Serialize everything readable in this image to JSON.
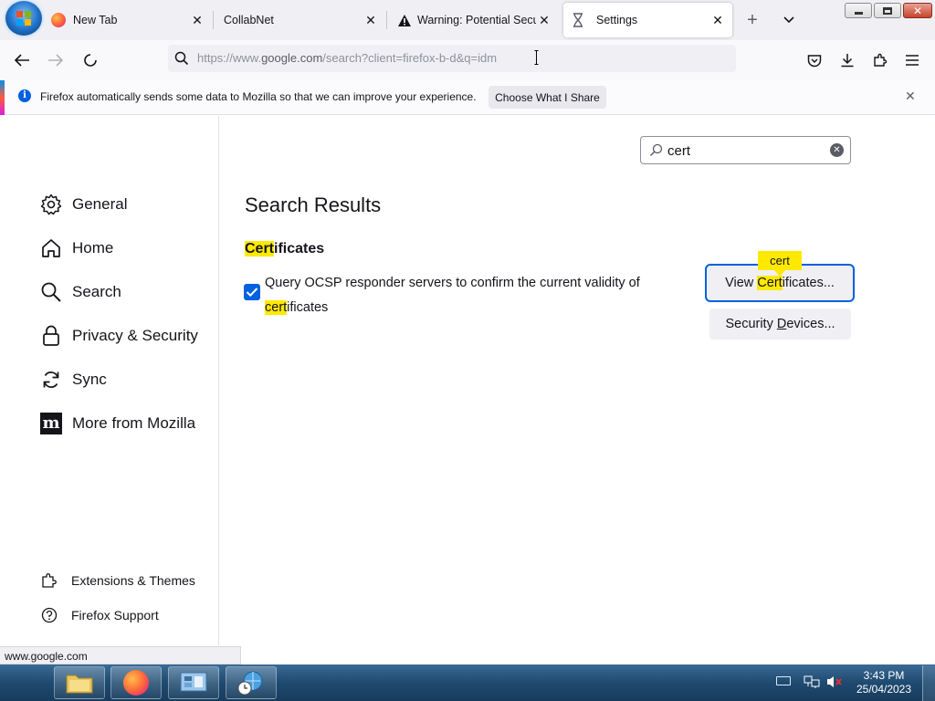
{
  "browser": {
    "tabs": [
      {
        "label": ""
      },
      {
        "label": "New Tab"
      },
      {
        "label": "CollabNet"
      },
      {
        "label": "Warning: Potential Secur"
      },
      {
        "label": "Settings"
      }
    ],
    "url_host_prefix": "https://www.",
    "url_host": "google.com",
    "url_rest": "/search?client=firefox-b-d&q=idm",
    "notification": {
      "message": "Firefox automatically sends some data to Mozilla so that we can improve your experience.",
      "button": "Choose What I Share"
    },
    "status_url": "www.google.com"
  },
  "settings": {
    "categories": [
      {
        "label": "General",
        "icon": "gear-icon"
      },
      {
        "label": "Home",
        "icon": "home-icon"
      },
      {
        "label": "Search",
        "icon": "search-icon"
      },
      {
        "label": "Privacy & Security",
        "icon": "lock-icon"
      },
      {
        "label": "Sync",
        "icon": "sync-icon"
      },
      {
        "label": "More from Mozilla",
        "icon": "mozilla-icon"
      }
    ],
    "footer": [
      {
        "label": "Extensions & Themes",
        "icon": "puzzle-icon"
      },
      {
        "label": "Firefox Support",
        "icon": "help-icon"
      }
    ],
    "search_value": "cert",
    "results_title": "Search Results",
    "group_heading_highlight": "Cert",
    "group_heading_rest": "ificates",
    "ocsp_label_part1": "Query OCSP responder servers to confirm the current validity of ",
    "ocsp_label_highlight": "cert",
    "ocsp_label_part2": "ificates",
    "ocsp_checked": true,
    "view_cert_pre": "View ",
    "view_cert_highlight": "Cert",
    "view_cert_post": "ificates...",
    "tooltip_text": "cert",
    "security_devices_pre": "Security ",
    "security_devices_accel": "D",
    "security_devices_post": "evices..."
  },
  "taskbar": {
    "time": "3:43 PM",
    "date": "25/04/2023"
  }
}
